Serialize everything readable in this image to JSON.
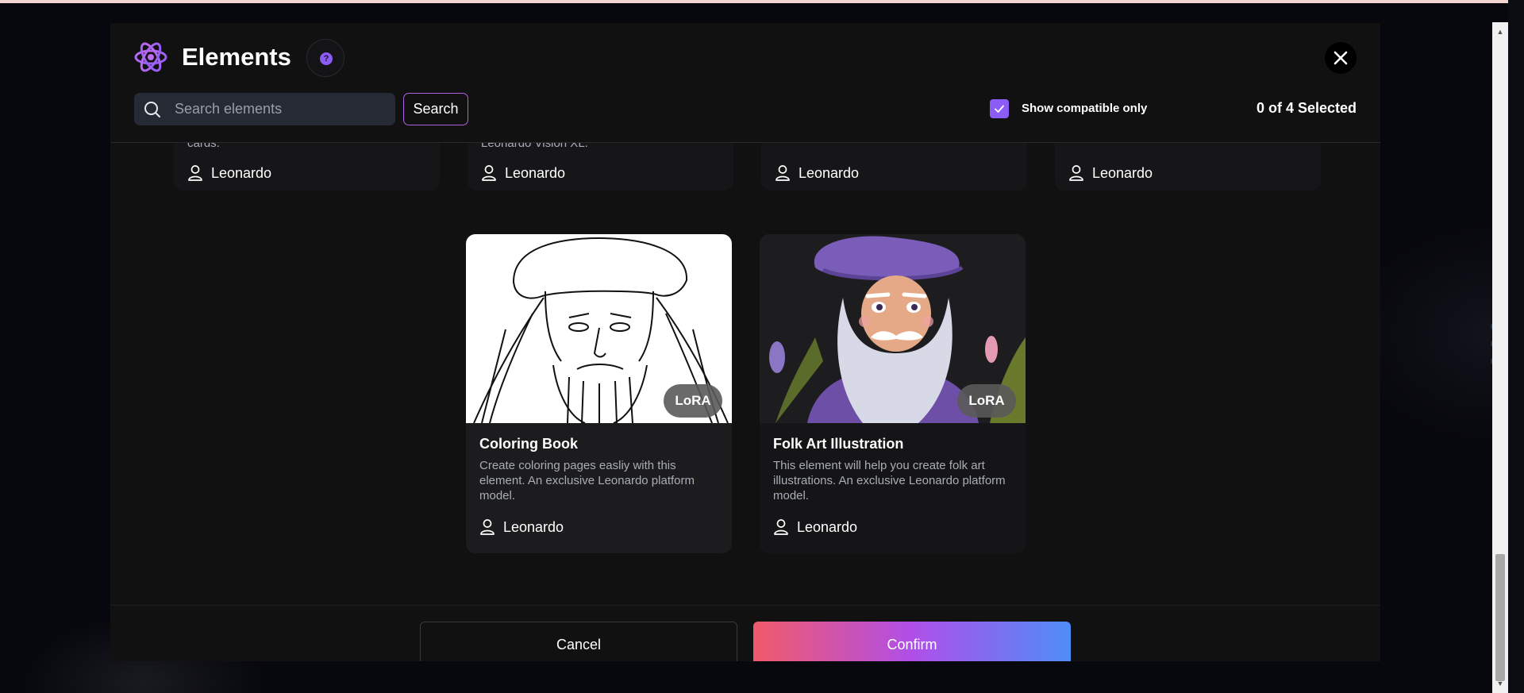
{
  "modal": {
    "title": "Elements",
    "help_icon": "?"
  },
  "search": {
    "placeholder": "Search elements",
    "value": "",
    "button_label": "Search"
  },
  "filters": {
    "compatible_only_label": "Show compatible only",
    "compatible_only_checked": true,
    "selected_count": "0 of 4 Selected"
  },
  "cards_top_row": [
    {
      "desc_tail": "cards.",
      "author": "Leonardo"
    },
    {
      "desc_tail": "Leonardo Vision XL.",
      "author": "Leonardo"
    },
    {
      "desc_tail": "",
      "author": "Leonardo"
    },
    {
      "desc_tail": "",
      "author": "Leonardo"
    }
  ],
  "cards": [
    {
      "title": "Coloring Book",
      "badge": "LoRA",
      "description": "Create coloring pages easliy with this element. An exclusive Leonardo platform model.",
      "author": "Leonardo"
    },
    {
      "title": "Folk Art Illustration",
      "badge": "LoRA",
      "description": "This element will help you create folk art illustrations. An exclusive Leonardo platform model.",
      "author": "Leonardo"
    }
  ],
  "footer": {
    "cancel_label": "Cancel",
    "confirm_label": "Confirm"
  },
  "colors": {
    "accent": "#8b5cf6",
    "confirm_gradient_start": "#f05a6a",
    "confirm_gradient_end": "#4e8df7"
  }
}
